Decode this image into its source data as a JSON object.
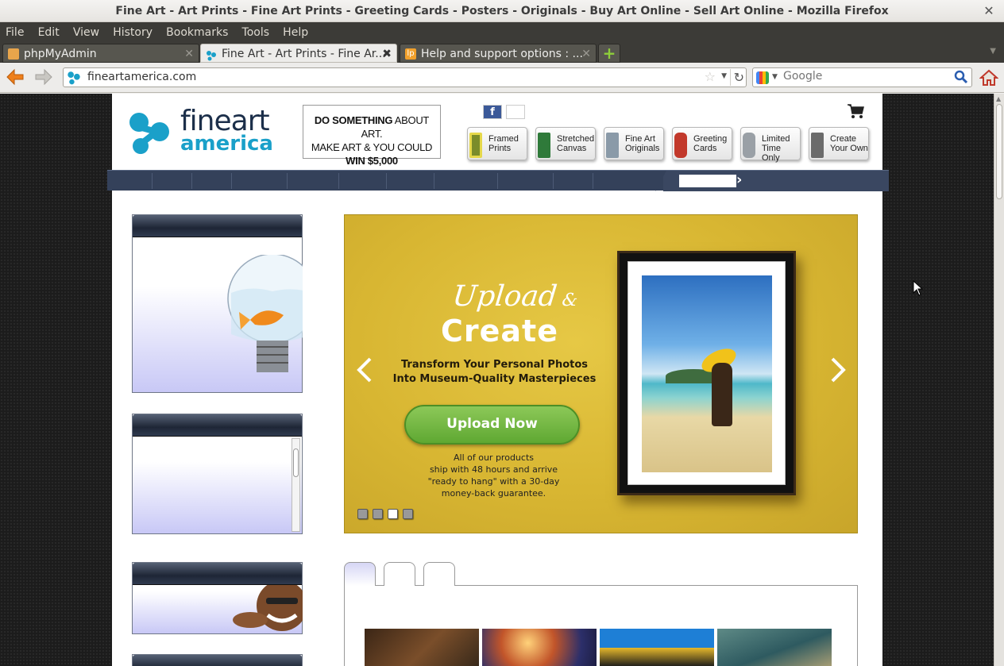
{
  "window": {
    "title": "Fine Art - Art Prints - Fine Art Prints - Greeting Cards - Posters - Originals - Buy Art Online - Sell Art Online - Mozilla Firefox"
  },
  "menu": [
    "File",
    "Edit",
    "View",
    "History",
    "Bookmarks",
    "Tools",
    "Help"
  ],
  "tabs": [
    {
      "label": "phpMyAdmin",
      "active": false
    },
    {
      "label": "Fine Art - Art Prints - Fine Ar...",
      "active": true
    },
    {
      "label": "Help and support options : ...",
      "active": false
    }
  ],
  "address": {
    "url": "fineartamerica.com"
  },
  "search": {
    "placeholder": "Google"
  },
  "site": {
    "logo_fine": "fine",
    "logo_art": "art",
    "logo_america": "america",
    "banner": {
      "line1a": "DO SOMETHING",
      "line1b": " ABOUT ART.",
      "line2": "MAKE ART & YOU COULD",
      "line3": "WIN $5,000"
    },
    "products": [
      {
        "line1": "Framed",
        "line2": "Prints",
        "color": "#7a8c2a"
      },
      {
        "line1": "Stretched",
        "line2": "Canvas",
        "color": "#2f7a3a"
      },
      {
        "line1": "Fine Art",
        "line2": "Originals",
        "color": "#8a9aa8"
      },
      {
        "line1": "Greeting",
        "line2": "Cards",
        "color": "#c2392b"
      },
      {
        "line1": "Limited",
        "line2": "Time Only",
        "color": "#9aa0a6"
      },
      {
        "line1": "Create",
        "line2": "Your Own",
        "color": "#6b6b6b"
      }
    ],
    "slider": {
      "title_1": "Upload",
      "title_amp": " &",
      "title_2": "Create",
      "subtitle_1": "Transform Your Personal Photos",
      "subtitle_2": "Into Museum-Quality Masterpieces",
      "button": "Upload Now",
      "ship_1": "All of our products",
      "ship_2": "ship with 48 hours and arrive",
      "ship_3": "\"ready to hang\" with a 30-day",
      "ship_4": "money-back guarantee.",
      "active_dot": 3
    }
  }
}
